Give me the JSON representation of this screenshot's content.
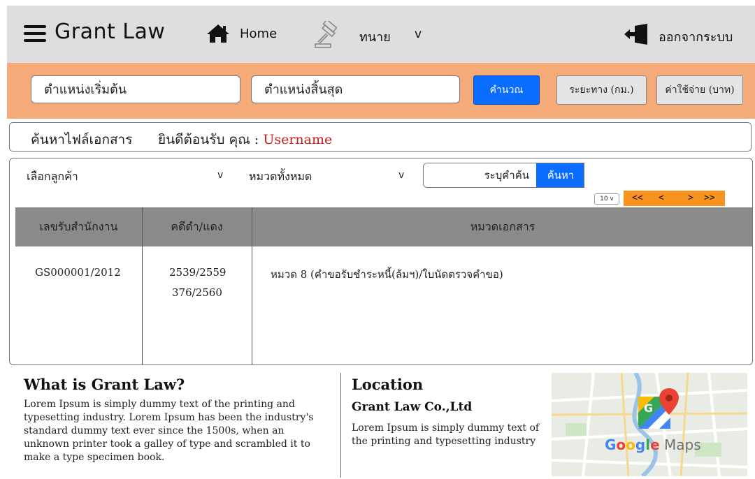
{
  "navbar": {
    "brand": "Grant Law",
    "home": "Home",
    "lawyer": "ทนาย",
    "caret": "v",
    "logout": "ออกจากระบบ",
    "icons": [
      "menu-icon",
      "home-icon",
      "gavel-icon",
      "logout-icon"
    ]
  },
  "route": {
    "start_placeholder": "ตำแหน่งเริ่มต้น",
    "end_placeholder": "ตำแหน่งสิ้นสุด",
    "calculate": "คำนวณ",
    "distance": "ระยะทาง (กม.)",
    "cost": "ค่าใช้จ่าย (บาท)"
  },
  "welcome": {
    "title": "ค้นหาไฟล์เอกสาร",
    "greeting": "ยินดีต้อนรับ คุณ : ",
    "username": "Username"
  },
  "filters": {
    "client_select": "เลือกลูกค้า",
    "category_select": "หมวดทั้งหมด",
    "caret": "v",
    "search_placeholder": "ระบุคำค้น",
    "search_button": "ค้นหา",
    "page_size": "10 v"
  },
  "pager": {
    "first": "<<",
    "prev": "<",
    "next": ">",
    "last": ">>"
  },
  "table": {
    "headers": [
      "เลขรับสำนักงาน",
      "คดีดำ/แดง",
      "หมวดเอกสาร"
    ],
    "rows": [
      {
        "office_no": "GS000001/2012",
        "case_black": "2539/2559",
        "case_red": "376/2560",
        "category": "หมวด 8 (คำขอรับชำระหนี้(ล้มฯ)/ใบนัดตรวจคำขอ)"
      }
    ]
  },
  "footer": {
    "about_title": "What is Grant Law?",
    "about_text": "Lorem Ipsum is simply dummy text of the printing and typesetting industry. Lorem Ipsum has been the industry's standard dummy text ever since the 1500s, when an unknown printer took a galley of type and scrambled it to make a type specimen book.",
    "location_title": "Location",
    "company": "Grant Law Co.,Ltd",
    "location_text": "Lorem Ipsum is simply dummy text of the printing and typesetting industry",
    "map_label": "Google Maps",
    "map_colors": {
      "blue": "#4285f4",
      "red": "#ea4335",
      "yellow": "#fbbc05",
      "green": "#34a853"
    }
  },
  "colors": {
    "navbar_bg": "#dedede",
    "searchbar_bg": "#f5aa7a",
    "primary_button": "#0a6dff",
    "pager_bg": "#f7931e",
    "table_header": "#8a8a8a",
    "username": "#c81d1d"
  }
}
